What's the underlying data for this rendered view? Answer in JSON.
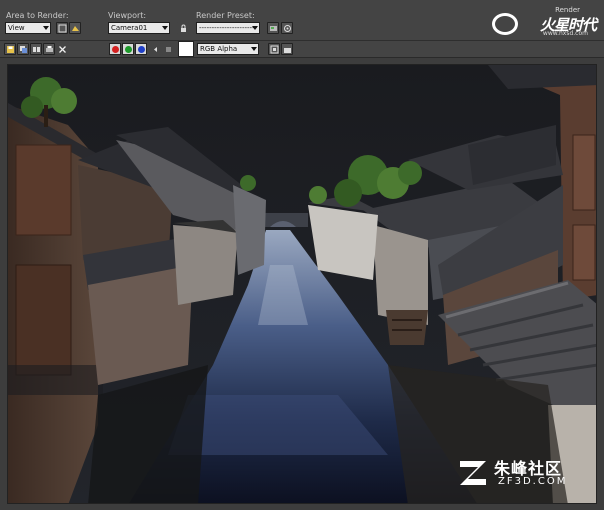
{
  "toolbar": {
    "area_to_render_label": "Area to Render:",
    "area_to_render_value": "View",
    "viewport_label": "Viewport:",
    "viewport_value": "Camera01",
    "render_preset_label": "Render Preset:",
    "render_preset_value": "-----------------------",
    "channel_value": "RGB Alpha"
  },
  "icons": {
    "lock": "lock-icon",
    "save": "save-icon",
    "copy": "copy-icon",
    "clone": "clone-icon",
    "print": "print-icon",
    "clear": "close-icon",
    "red": "red-channel-icon",
    "green": "green-channel-icon",
    "blue": "blue-channel-icon"
  },
  "colors": {
    "channel_red": "#d42020",
    "channel_green": "#1d9a2a",
    "channel_blue": "#2040c8"
  },
  "logo": {
    "top": "Render",
    "main": "火星时代",
    "url": "www.hxsd.com"
  },
  "watermark": {
    "chinese": "朱峰社区",
    "url": "ZF3D.COM"
  }
}
